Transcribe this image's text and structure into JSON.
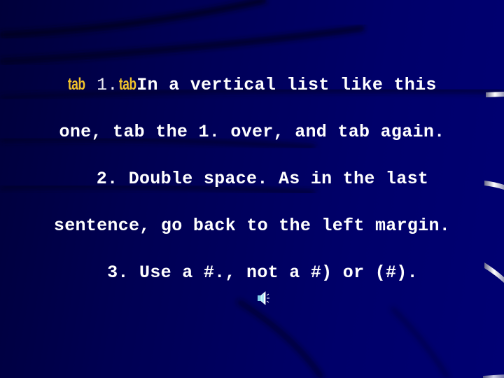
{
  "slide": {
    "background_color": "#000066",
    "text_color": "#ffffff",
    "accent_color": "#f2c42a",
    "lines": [
      {
        "tab_label_1": "tab",
        "number": " 1.",
        "tab_label_2": "tab",
        "text": "In a vertical list like this"
      },
      {
        "text": "one, tab the 1. over, and tab again."
      },
      {
        "text": "2. Double space. As in the last"
      },
      {
        "text": "sentence, go back to the left margin."
      },
      {
        "text": "3. Use a #., not a #) or (#)."
      }
    ],
    "audio_icon": "speaker-icon"
  }
}
